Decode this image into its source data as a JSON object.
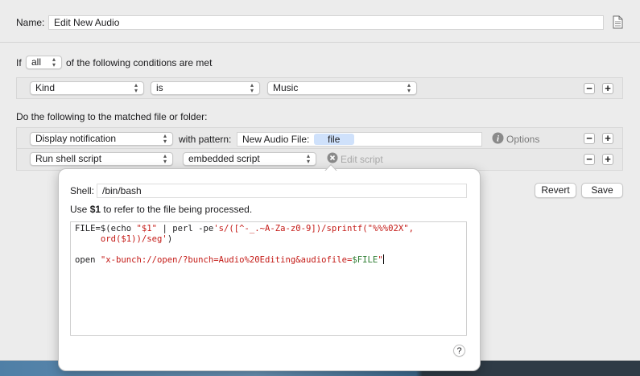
{
  "name_row": {
    "label": "Name:",
    "value": "Edit New Audio"
  },
  "conditions": {
    "if_label": "If",
    "quantifier": "all",
    "suffix": "of the following conditions are met",
    "rule": {
      "attribute": "Kind",
      "operator": "is",
      "value": "Music"
    }
  },
  "actions_header": "Do the following to the matched file or folder:",
  "action1": {
    "type": "Display notification",
    "with_pattern_label": "with pattern:",
    "pattern_text": "New Audio File:",
    "pattern_token": "file",
    "options_label": "Options"
  },
  "action2": {
    "type": "Run shell script",
    "source": "embedded script",
    "edit_label": "Edit script"
  },
  "buttons": {
    "revert": "Revert",
    "save": "Save",
    "plus": "+",
    "minus": "−"
  },
  "popover": {
    "shell_label": "Shell:",
    "shell_value": "/bin/bash",
    "hint_prefix": "Use ",
    "hint_var": "$1",
    "hint_suffix": " to refer to the file being processed.",
    "help": "?",
    "code": {
      "l1_a": "FILE=$(echo ",
      "l1_b": "\"$1\"",
      "l1_c": " | perl -pe",
      "l1_d": "'s/([^-_.~A-Za-z0-9])/sprintf(\"%%%02X\",",
      "l2": "     ord($1))/seg'",
      "l2_end": ")",
      "l4_a": "open ",
      "l4_b": "\"x-bunch://open/?bunch=Audio%20Editing&audiofile=",
      "l4_c": "$FILE",
      "l4_d": "\""
    }
  },
  "icons": {
    "document": "document-icon",
    "info": "info-icon",
    "close": "close-circle-icon"
  },
  "colors": {
    "token_bg": "#cfe1fb",
    "string": "#c41a16",
    "variable": "#2e7d32"
  }
}
